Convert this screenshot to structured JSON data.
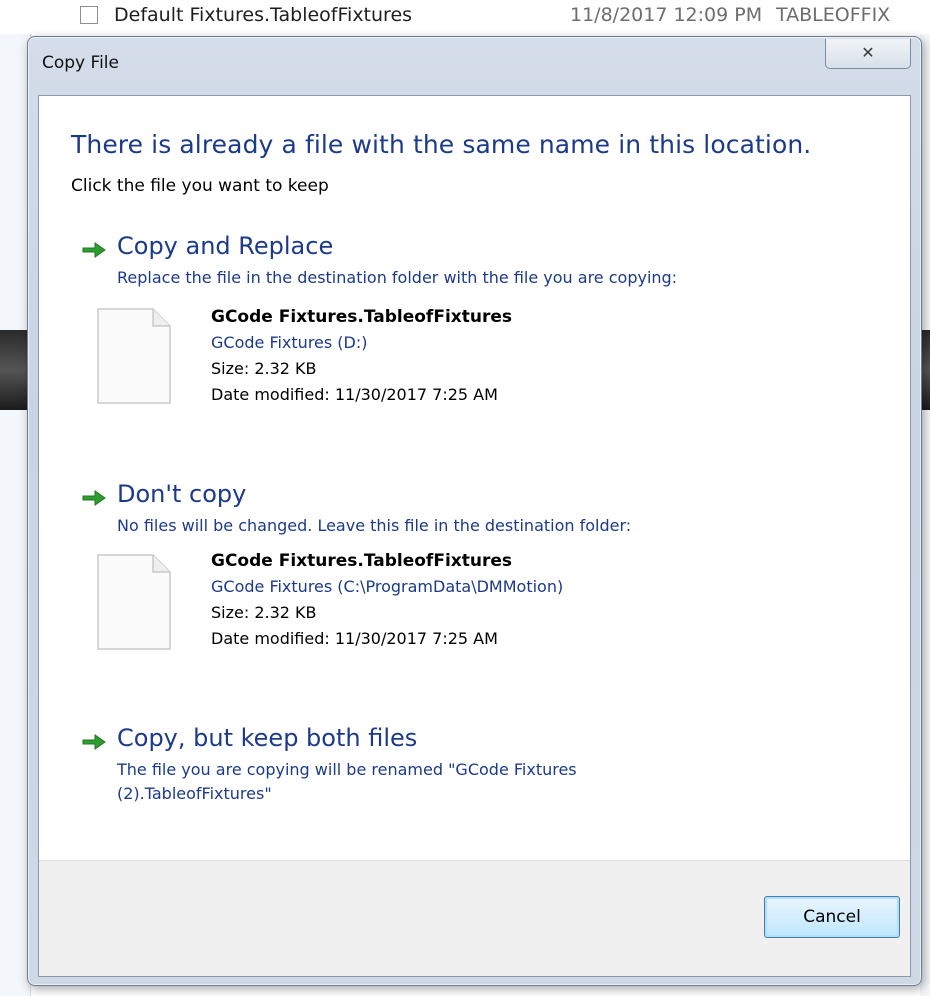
{
  "background": {
    "row_name": "Default Fixtures.TableofFixtures",
    "row_date": "11/8/2017 12:09 PM",
    "row_type": "TABLEOFFIX"
  },
  "dialog": {
    "title": "Copy File",
    "close_glyph": "✕",
    "heading": "There is already a file with the same name in this location.",
    "subheading": "Click the file you want to keep",
    "options": [
      {
        "title": "Copy and Replace",
        "description": "Replace the file in the destination folder with the file you are copying:",
        "file": {
          "name": "GCode Fixtures.TableofFixtures",
          "location": "GCode Fixtures (D:)",
          "size": "Size: 2.32 KB",
          "modified": "Date modified: 11/30/2017 7:25 AM"
        }
      },
      {
        "title": "Don't copy",
        "description": "No files will be changed. Leave this file in the destination folder:",
        "file": {
          "name": "GCode Fixtures.TableofFixtures",
          "location": "GCode Fixtures (C:\\ProgramData\\DMMotion)",
          "size": "Size: 2.32 KB",
          "modified": "Date modified: 11/30/2017 7:25 AM"
        }
      },
      {
        "title": "Copy, but keep both files",
        "description_line1": "The file you are copying will be renamed \"GCode Fixtures",
        "description_line2": "(2).TableofFixtures\""
      }
    ],
    "cancel_label": "Cancel"
  },
  "colors": {
    "link_blue": "#1c3a8a",
    "arrow_green": "#2e9c2e",
    "footer_bg": "#f0f0f0"
  },
  "icons": {
    "arrow": "green-right-arrow-icon",
    "file": "blank-document-icon",
    "close": "close-icon"
  }
}
